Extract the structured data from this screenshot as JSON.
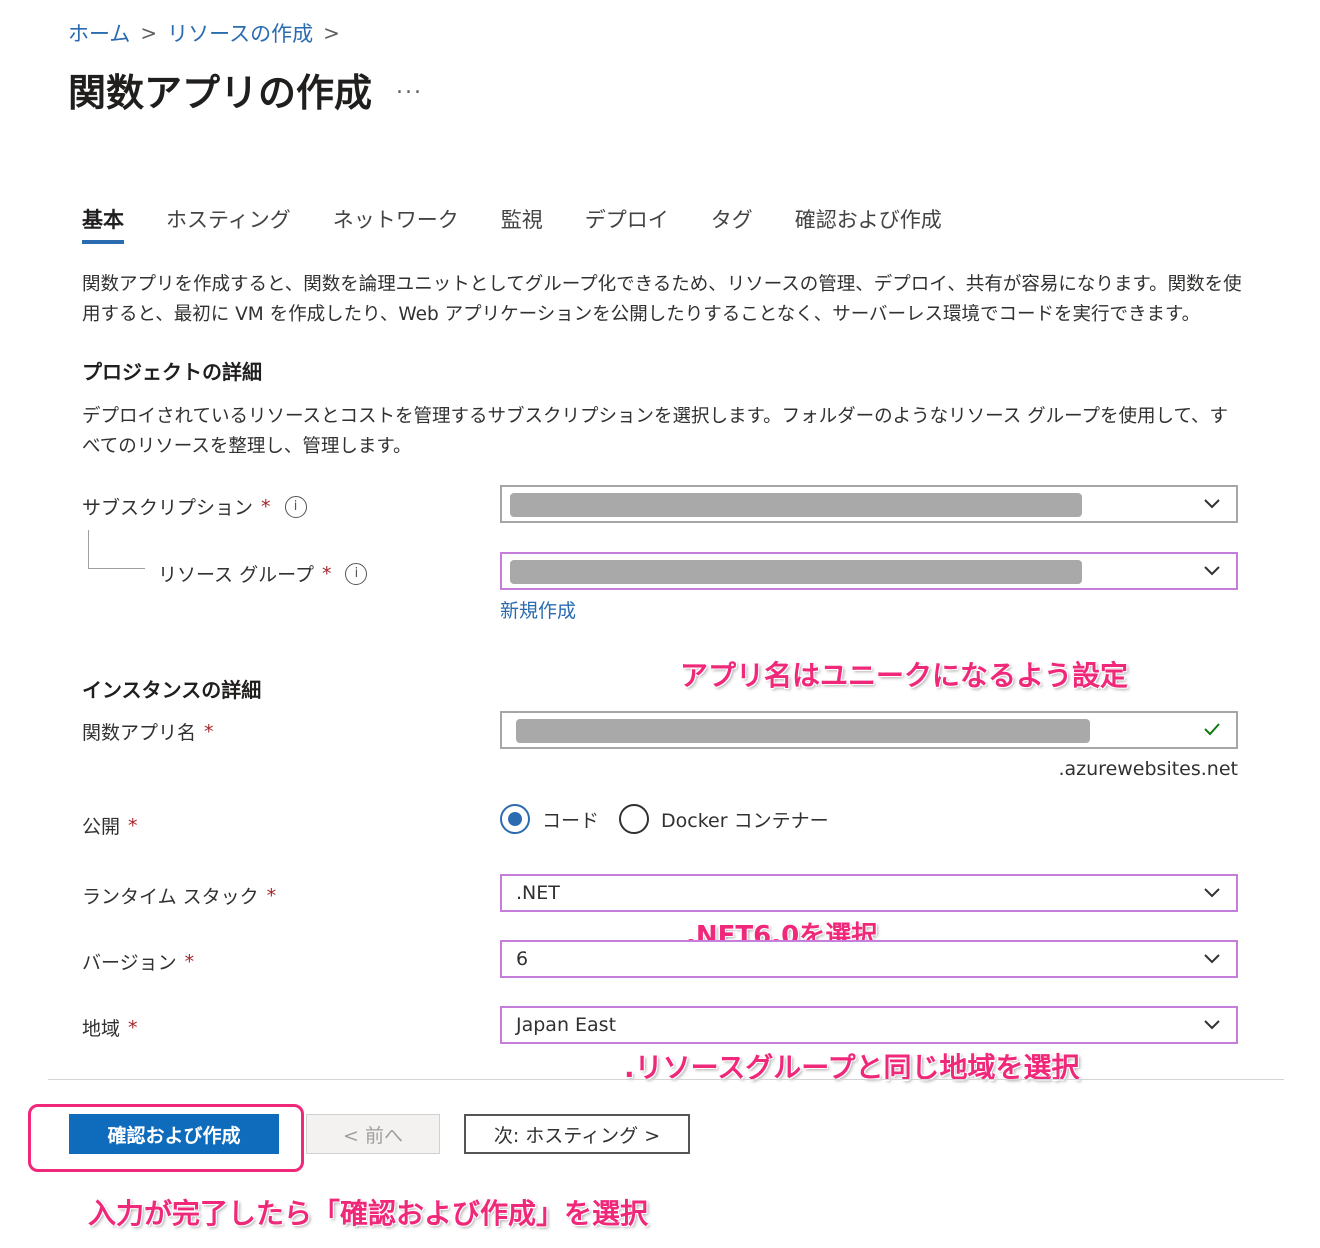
{
  "breadcrumb": {
    "home": "ホーム",
    "create_resource": "リソースの作成",
    "sep": ">"
  },
  "page": {
    "title": "関数アプリの作成",
    "more": "..."
  },
  "tabs": [
    {
      "label": "基本"
    },
    {
      "label": "ホスティング"
    },
    {
      "label": "ネットワーク"
    },
    {
      "label": "監視"
    },
    {
      "label": "デプロイ"
    },
    {
      "label": "タグ"
    },
    {
      "label": "確認および作成"
    }
  ],
  "intro": "関数アプリを作成すると、関数を論理ユニットとしてグループ化できるため、リソースの管理、デプロイ、共有が容易になります。関数を使用すると、最初に VM を作成したり、Web アプリケーションを公開したりすることなく、サーバーレス環境でコードを実行できます。",
  "project": {
    "heading": "プロジェクトの詳細",
    "desc": "デプロイされているリソースとコストを管理するサブスクリプションを選択します。フォルダーのようなリソース グループを使用して、すべてのリソースを整理し、管理します。",
    "subscription_label": "サブスクリプション",
    "resource_group_label": "リソース グループ",
    "new_link": "新規作成"
  },
  "instance": {
    "heading": "インスタンスの詳細",
    "app_name_label": "関数アプリ名",
    "app_name_suffix": ".azurewebsites.net",
    "publish_label": "公開",
    "publish_code": "コード",
    "publish_docker": "Docker コンテナー",
    "runtime_label": "ランタイム スタック",
    "runtime_value": ".NET",
    "version_label": "バージョン",
    "version_value": "6",
    "region_label": "地域",
    "region_value": "Japan East"
  },
  "required_mark": "*",
  "info_glyph": "i",
  "annotations": {
    "app_name": "アプリ名はユニークになるよう設定",
    "dotnet": ".NET6.0を選択",
    "region": ".リソースグループと同じ地域を選択",
    "review": "入力が完了したら「確認および作成」を選択"
  },
  "buttons": {
    "review": "確認および作成",
    "prev": "< 前へ",
    "next": "次: ホスティング >"
  },
  "colors": {
    "accent": "#0f6cbd",
    "link": "#2b6cb0",
    "annotation": "#f0287a",
    "check": "#107c10"
  }
}
